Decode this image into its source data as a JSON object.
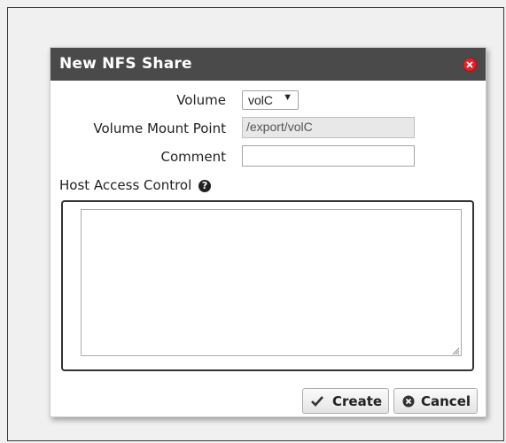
{
  "dialog": {
    "title": "New NFS Share",
    "volume_label": "Volume",
    "volume_value": "volC",
    "mount_label": "Volume Mount Point",
    "mount_value": "/export/volC",
    "comment_label": "Comment",
    "comment_value": "",
    "host_access_label": "Host Access Control",
    "host_access_value": "",
    "create_label": "Create",
    "cancel_label": "Cancel"
  },
  "icons": {
    "close": "close-icon",
    "help": "question-circle-icon",
    "create": "check-icon",
    "cancel": "cancel-circle-icon"
  },
  "colors": {
    "titlebar": "#4a4a4a",
    "close": "#e2222a"
  }
}
